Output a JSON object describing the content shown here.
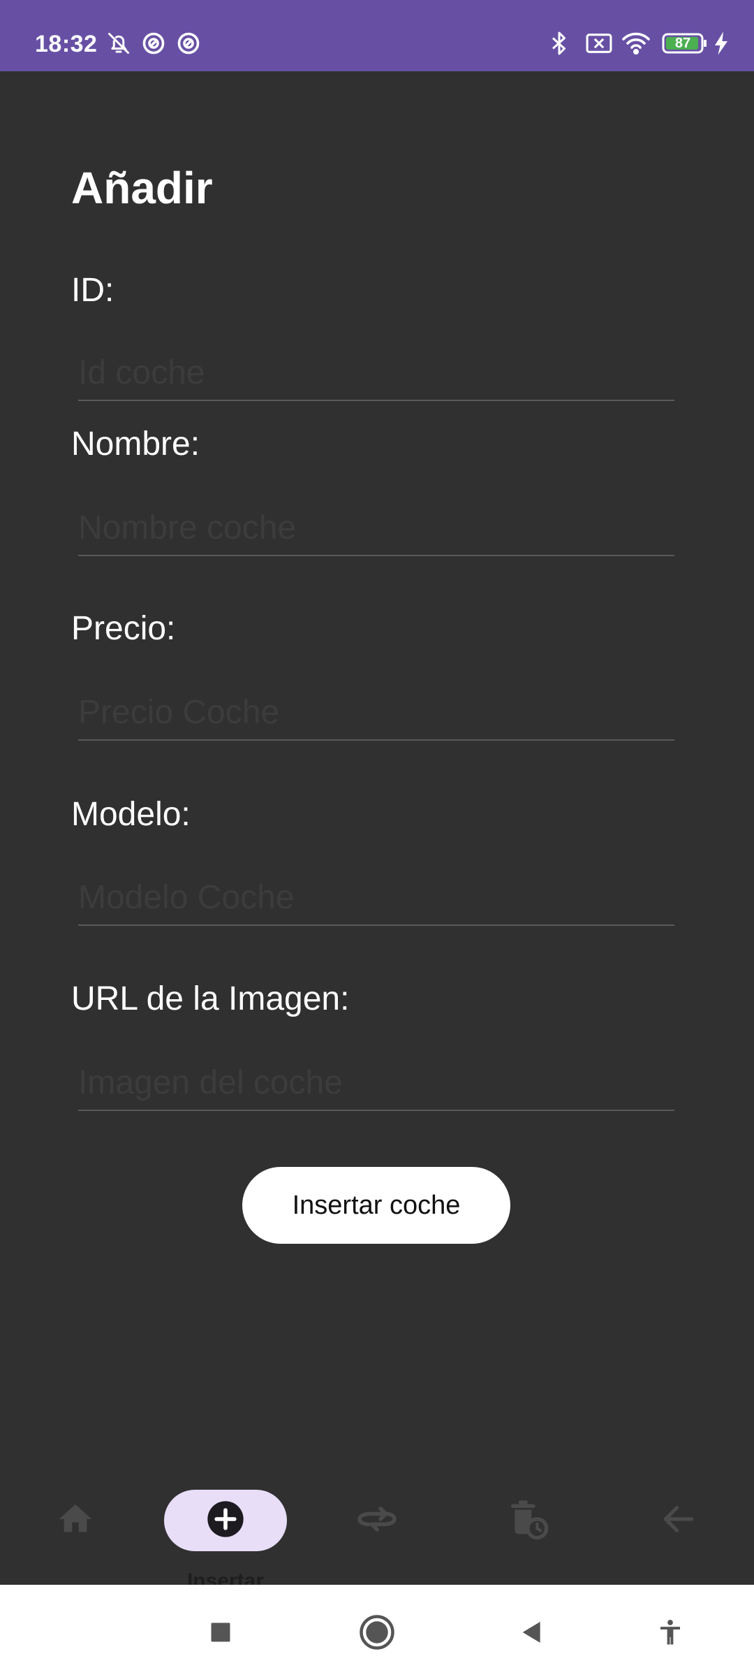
{
  "status_bar": {
    "time": "18:32",
    "battery_level": "87",
    "left_icons": [
      "bell-off-icon",
      "sync-icon",
      "sync-icon"
    ],
    "right_icons": [
      "bluetooth-icon",
      "no-sim-icon",
      "wifi-icon",
      "battery-icon",
      "charging-icon"
    ]
  },
  "page": {
    "title": "Añadir"
  },
  "form": {
    "fields": [
      {
        "label": "ID:",
        "placeholder": "Id coche",
        "value": ""
      },
      {
        "label": "Nombre:",
        "placeholder": "Nombre coche",
        "value": ""
      },
      {
        "label": "Precio:",
        "placeholder": "Precio Coche",
        "value": ""
      },
      {
        "label": "Modelo:",
        "placeholder": "Modelo Coche",
        "value": ""
      },
      {
        "label": "URL de la Imagen:",
        "placeholder": "Imagen del coche",
        "value": ""
      }
    ],
    "submit_label": "Insertar coche"
  },
  "bottom_nav": {
    "items": [
      {
        "icon": "home-icon",
        "label": "",
        "active": false
      },
      {
        "icon": "add-circle-icon",
        "label": "Insertar",
        "active": true
      },
      {
        "icon": "swap-icon",
        "label": "",
        "active": false
      },
      {
        "icon": "delete-clock-icon",
        "label": "",
        "active": false
      },
      {
        "icon": "arrow-back-icon",
        "label": "",
        "active": false
      }
    ]
  },
  "system_nav": {
    "buttons": [
      "recents-icon",
      "home-circle-icon",
      "back-triangle-icon",
      "accessibility-icon"
    ]
  },
  "colors": {
    "status_bar": "#6750a4",
    "background": "#303030",
    "active_pill": "#e8def8",
    "nav_icon_inactive": "#4a4a4a"
  }
}
